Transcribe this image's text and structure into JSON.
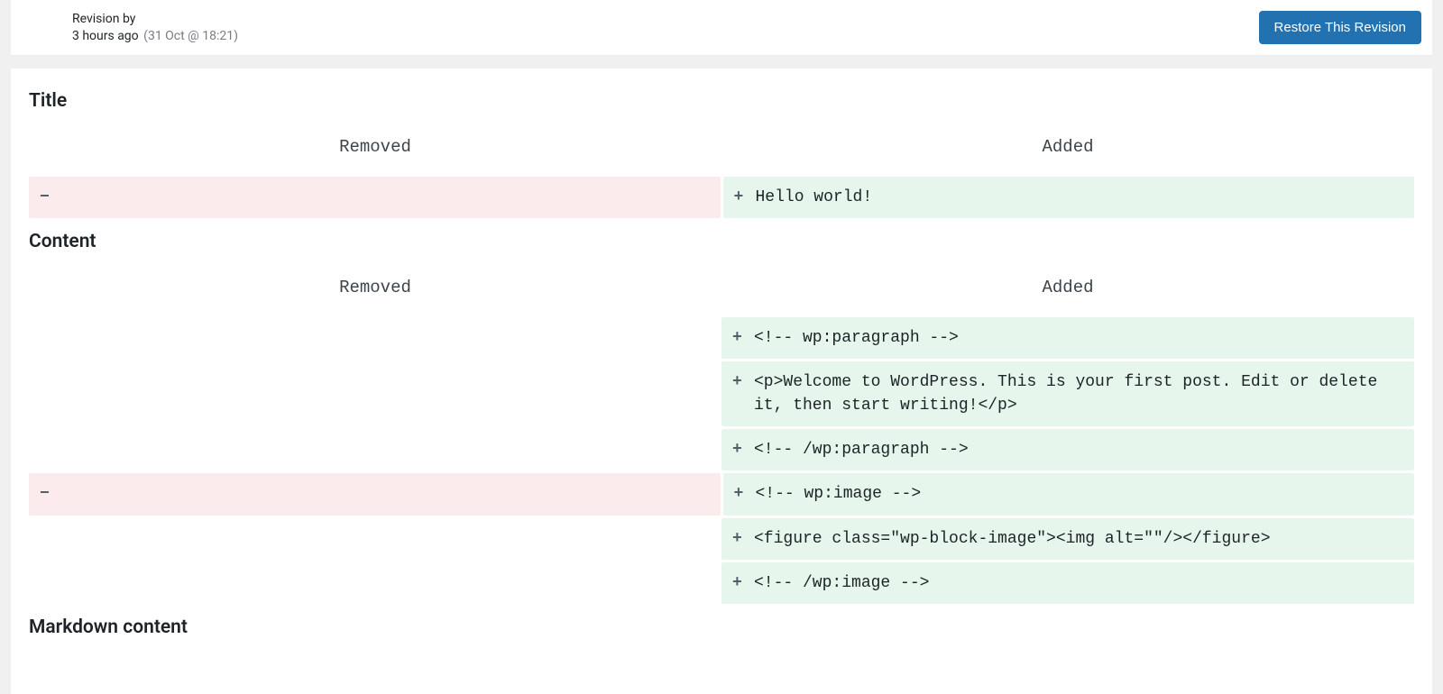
{
  "header": {
    "line1": "Revision by",
    "relative_time": "3 hours ago",
    "abs_time": "(31 Oct @ 18:21)",
    "restore_label": "Restore This Revision"
  },
  "diff_columns": {
    "removed_label": "Removed",
    "added_label": "Added"
  },
  "sections": [
    {
      "title": "Title",
      "rows": [
        {
          "removed": "",
          "added": "Hello world!"
        }
      ]
    },
    {
      "title": "Content",
      "rows": [
        {
          "removed": null,
          "added": "<!-- wp:paragraph -->"
        },
        {
          "removed": null,
          "added": "<p>Welcome to WordPress. This is your first post. Edit or delete it, then start writing!</p>"
        },
        {
          "removed": null,
          "added": "<!-- /wp:paragraph -->"
        },
        {
          "removed": "",
          "added": "<!-- wp:image -->"
        },
        {
          "removed": null,
          "added": "<figure class=\"wp-block-image\"><img alt=\"\"/></figure>"
        },
        {
          "removed": null,
          "added": "<!-- /wp:image -->"
        }
      ]
    },
    {
      "title": "Markdown content",
      "rows": []
    }
  ]
}
